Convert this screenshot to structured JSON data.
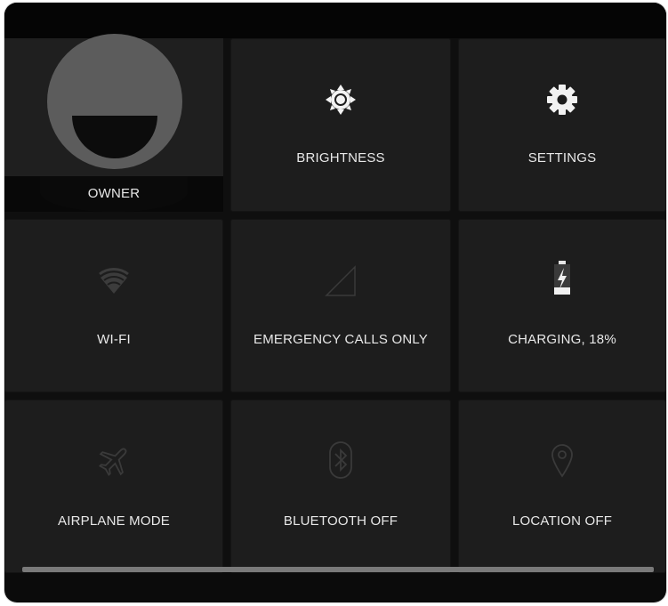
{
  "quick_settings": {
    "owner": {
      "label": "OWNER"
    },
    "brightness": {
      "label": "BRIGHTNESS",
      "icon": "brightness-icon"
    },
    "settings": {
      "label": "SETTINGS",
      "icon": "gear-icon"
    },
    "wifi": {
      "label": "WI-FI",
      "icon": "wifi-icon"
    },
    "signal": {
      "label": "EMERGENCY CALLS ONLY",
      "icon": "signal-icon"
    },
    "battery": {
      "label": "CHARGING, 18%",
      "icon": "battery-charging-icon",
      "level_fraction": 0.18
    },
    "airplane": {
      "label": "AIRPLANE MODE",
      "icon": "airplane-icon"
    },
    "bluetooth": {
      "label": "BLUETOOTH OFF",
      "icon": "bluetooth-icon"
    },
    "location": {
      "label": "LOCATION OFF",
      "icon": "location-pin-icon"
    }
  },
  "colors": {
    "panel_bg": "#0f0f0f",
    "tile_bg": "#1d1d1d",
    "text": "#e8e8e8",
    "dim_icon": "#3a3a3a"
  }
}
